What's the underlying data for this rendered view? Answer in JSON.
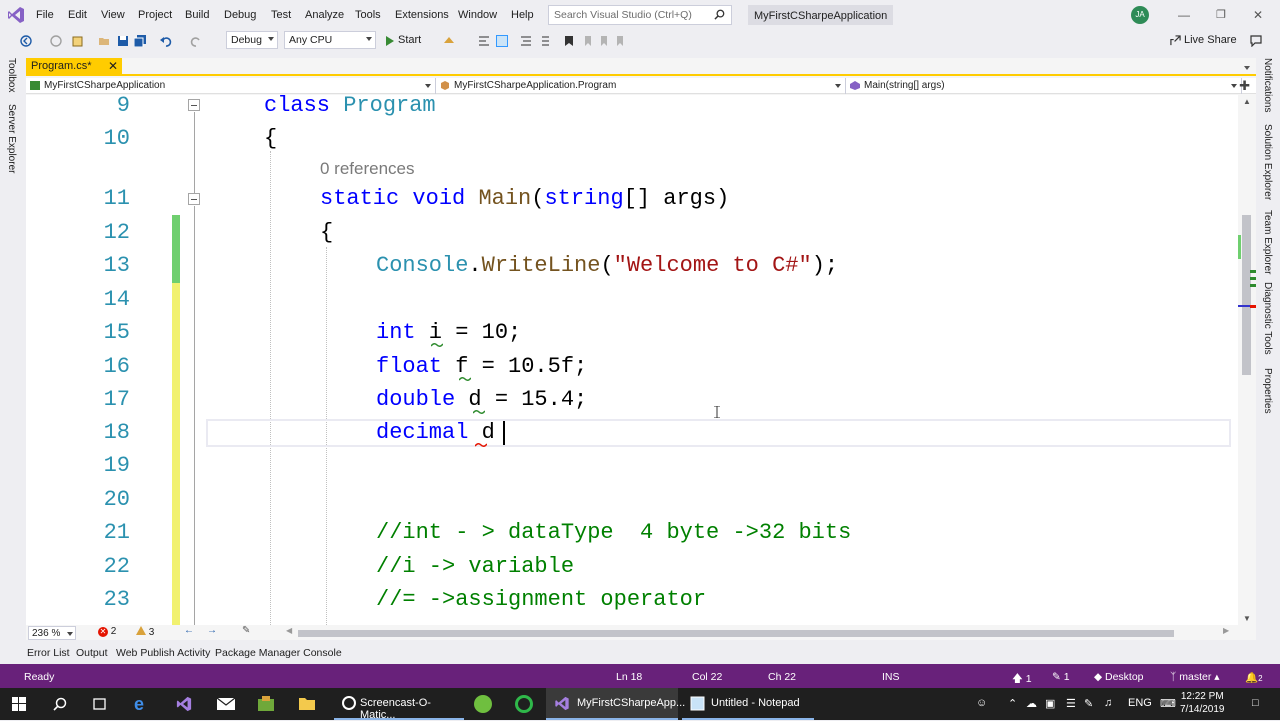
{
  "menu": {
    "items": [
      "File",
      "Edit",
      "View",
      "Project",
      "Build",
      "Debug",
      "Test",
      "Analyze",
      "Tools",
      "Extensions",
      "Window",
      "Help"
    ],
    "search_placeholder": "Search Visual Studio (Ctrl+Q)",
    "solution_name": "MyFirstCSharpeApplication",
    "avatar_initials": "JA"
  },
  "toolbar": {
    "config": "Debug",
    "platform": "Any CPU",
    "start_label": "Start",
    "live_share": "Live Share"
  },
  "left_strip": [
    "Toolbox",
    "Server Explorer"
  ],
  "right_strip": [
    "Notifications",
    "Solution Explorer",
    "Team Explorer",
    "Diagnostic Tools",
    "Properties"
  ],
  "tab": {
    "title": "Program.cs*"
  },
  "navbar": {
    "project": "MyFirstCSharpeApplication",
    "type": "MyFirstCSharpeApplication.Program",
    "member": "Main(string[] args)"
  },
  "editor": {
    "line_numbers": [
      "9",
      "10",
      "11",
      "12",
      "13",
      "14",
      "15",
      "16",
      "17",
      "18",
      "19",
      "20",
      "21",
      "22",
      "23"
    ],
    "codelens": "0 references",
    "lines": {
      "l9_kw": "class",
      "l9_ty": "Program",
      "l10": "{",
      "l11_kw1": "static",
      "l11_kw2": "void",
      "l11_me": "Main",
      "l11_p1": "(",
      "l11_kw3": "string",
      "l11_p2": "[] args)",
      "l12": "{",
      "l13_ty": "Console",
      "l13_dot": ".",
      "l13_me": "WriteLine",
      "l13_p1": "(",
      "l13_st": "\"Welcome to C#\"",
      "l13_p2": ");",
      "l15_kw": "int",
      "l15_rest": " i = 10;",
      "l16_kw": "float",
      "l16_rest": " f = 10.5f;",
      "l17_kw": "double",
      "l17_rest": " d = 15.4;",
      "l18_kw": "decimal",
      "l18_rest": " d",
      "l21": "//int - > dataType  4 byte ->32 bits",
      "l22": "//i -> variable",
      "l23": "//= ->assignment operator"
    }
  },
  "zoom": "236 %",
  "errors": "2",
  "warnings": "3",
  "bottom_tabs": [
    "Error List",
    "Output",
    "Web Publish Activity",
    "Package Manager Console"
  ],
  "status": {
    "ready": "Ready",
    "ln": "Ln 18",
    "col": "Col 22",
    "ch": "Ch 22",
    "ins": "INS",
    "up": "1",
    "pencil": "1",
    "desktop": "Desktop",
    "branch": "master",
    "bell_count": "2"
  },
  "taskbar": {
    "items": [
      "Screencast-O-Matic...",
      "MyFirstCSharpeApp...",
      "Untitled - Notepad"
    ],
    "lang": "ENG",
    "time": "12:22 PM",
    "date": "7/14/2019"
  },
  "colors": {
    "accent": "#68217a",
    "tab_active": "#ffcc00",
    "keyword": "#0000ff",
    "type": "#2b91af",
    "string": "#a31515",
    "comment": "#008000",
    "line_number": "#2b91af"
  }
}
